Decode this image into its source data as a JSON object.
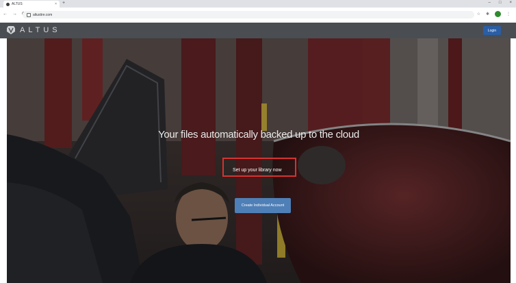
{
  "browser": {
    "tab_title": "ALTUS",
    "tab_close": "×",
    "new_tab": "+",
    "url": "altustire.com",
    "nav": {
      "back": "←",
      "forward": "→",
      "reload": "C"
    },
    "window_controls": [
      "–",
      "□",
      "×"
    ]
  },
  "header": {
    "logo_text": "ALTUS",
    "login_label": "Login"
  },
  "hero": {
    "headline": "Your files automatically backed up to the cloud",
    "setup_text": "Set up your library now",
    "create_button": "Create Individual Account"
  },
  "colors": {
    "header_bg": "#4a4d52",
    "login_bg": "#2a5ea6",
    "create_bg": "#4f7fb7",
    "highlight": "#d8322f"
  }
}
